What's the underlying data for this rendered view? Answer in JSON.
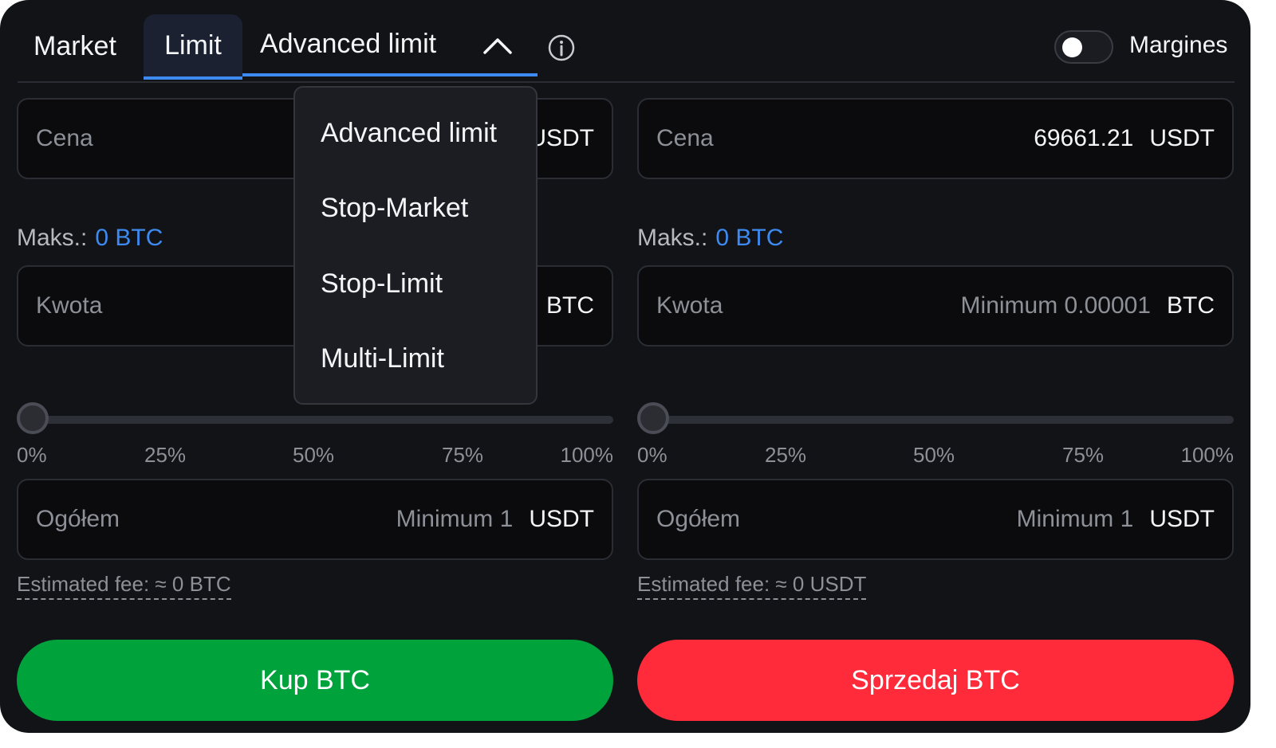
{
  "tabs": {
    "market": "Market",
    "limit": "Limit",
    "advanced": "Advanced limit",
    "margin_label": "Margines"
  },
  "dropdown": {
    "items": [
      "Advanced limit",
      "Stop-Market",
      "Stop-Limit",
      "Multi-Limit"
    ]
  },
  "buy": {
    "price_label": "Cena",
    "price_unit": "USDT",
    "max_label": "Maks.:",
    "max_value": "0 BTC",
    "amount_label": "Kwota",
    "amount_unit": "BTC",
    "slider_ticks": [
      "0%",
      "25%",
      "50%",
      "75%",
      "100%"
    ],
    "total_label": "Ogółem",
    "total_hint": "Minimum 1",
    "total_unit": "USDT",
    "fee": "Estimated fee: ≈ 0 BTC",
    "button": "Kup BTC"
  },
  "sell": {
    "price_label": "Cena",
    "price_value": "69661.21",
    "price_unit": "USDT",
    "max_label": "Maks.:",
    "max_value": "0 BTC",
    "amount_label": "Kwota",
    "amount_hint": "Minimum 0.00001",
    "amount_unit": "BTC",
    "slider_ticks": [
      "0%",
      "25%",
      "50%",
      "75%",
      "100%"
    ],
    "total_label": "Ogółem",
    "total_hint": "Minimum 1",
    "total_unit": "USDT",
    "fee": "Estimated fee: ≈ 0 USDT",
    "button": "Sprzedaj BTC"
  },
  "state": {
    "margin_enabled": false,
    "buy_slider_percent": 0,
    "sell_slider_percent": 0
  },
  "colors": {
    "background": "#121317",
    "accent": "#3d8bf2",
    "buy": "#00a23c",
    "sell": "#ff2a3a"
  }
}
